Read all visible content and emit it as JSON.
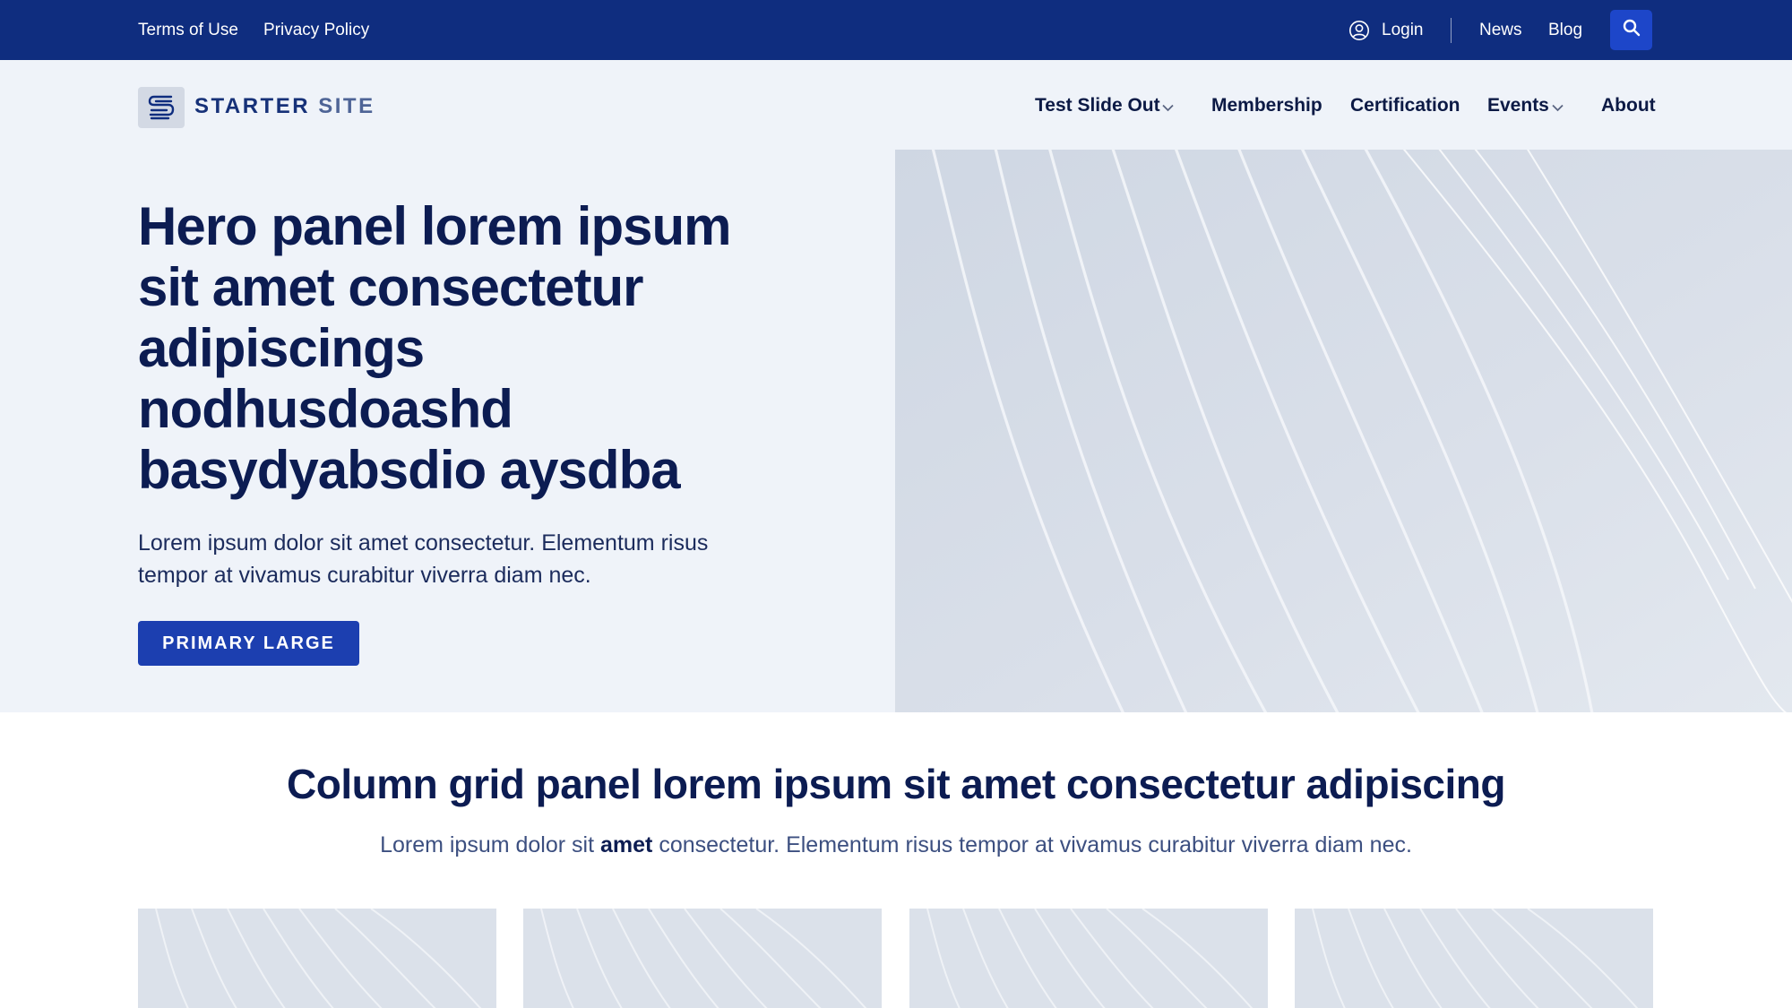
{
  "utility_bar": {
    "terms_label": "Terms of Use",
    "privacy_label": "Privacy Policy",
    "login_label": "Login",
    "news_label": "News",
    "blog_label": "Blog",
    "user_icon": "user-circle-icon",
    "search_icon": "search-icon"
  },
  "header": {
    "logo_word1": "STARTER",
    "logo_word2": "SITE",
    "nav": [
      {
        "label": "Test Slide Out",
        "has_dropdown": true
      },
      {
        "label": "Membership",
        "has_dropdown": false
      },
      {
        "label": "Certification",
        "has_dropdown": false
      },
      {
        "label": "Events",
        "has_dropdown": true
      },
      {
        "label": "About",
        "has_dropdown": false
      }
    ]
  },
  "hero": {
    "title": "Hero panel lorem ipsum sit amet consectetur adipiscings nodhusdoashd basydyabsdio aysdba",
    "subtitle": "Lorem ipsum dolor sit amet consectetur. Elementum risus tempor at vivamus curabitur viverra diam nec.",
    "button_label": "PRIMARY LARGE"
  },
  "column_grid": {
    "title": "Column grid panel lorem ipsum sit amet consectetur adipiscing",
    "subtitle_before": "Lorem ipsum dolor sit ",
    "subtitle_bold": "amet",
    "subtitle_after": " consectetur. Elementum risus tempor at vivamus curabitur viverra diam nec."
  },
  "colors": {
    "utility_bg": "#0f2d7f",
    "primary": "#1c3fb0",
    "search_bg": "#1d46c9",
    "hero_bg": "#eff3f9",
    "heading": "#0c1c52"
  }
}
